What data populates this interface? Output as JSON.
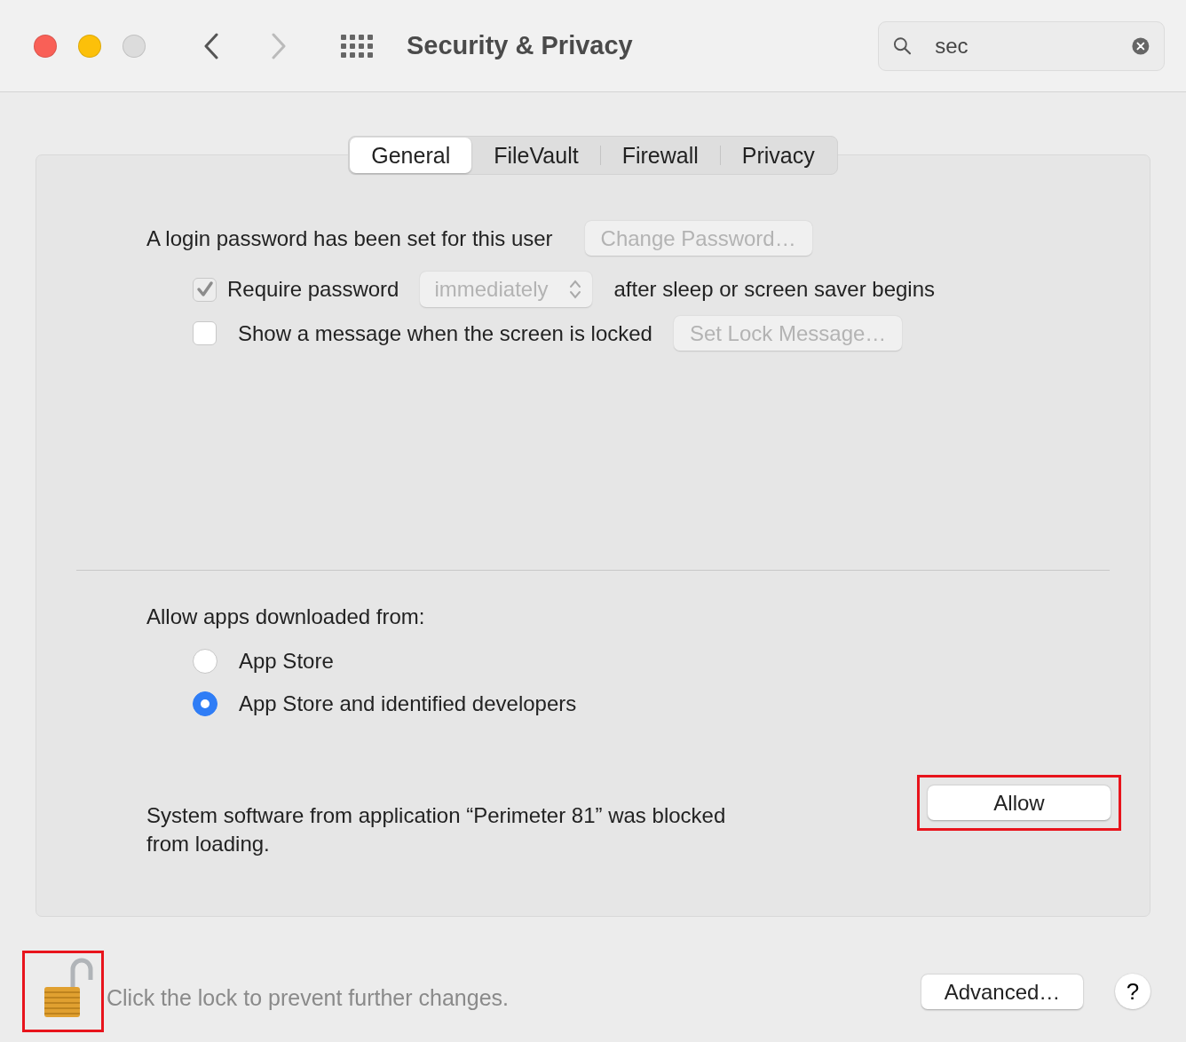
{
  "window": {
    "title": "Security & Privacy",
    "traffic_lights": [
      {
        "color": "#f96057"
      },
      {
        "color": "#fcc00a"
      },
      {
        "color": "#dcdcdc"
      }
    ]
  },
  "nav": {
    "back_enabled": true,
    "forward_enabled": false
  },
  "search": {
    "value": "sec"
  },
  "tabs": [
    {
      "label": "General",
      "selected": true
    },
    {
      "label": "FileVault",
      "selected": false
    },
    {
      "label": "Firewall",
      "selected": false
    },
    {
      "label": "Privacy",
      "selected": false
    }
  ],
  "general": {
    "login_text": "A login password has been set for this user",
    "change_password": {
      "label": "Change Password…",
      "disabled": true
    },
    "require_password": {
      "label": "Require password",
      "checked": true,
      "disabled": true,
      "delay": "immediately",
      "suffix": "after sleep or screen saver begins"
    },
    "show_message": {
      "label": "Show a message when the screen is locked",
      "checked": false,
      "button": {
        "label": "Set Lock Message…",
        "disabled": true
      }
    }
  },
  "allow_apps": {
    "label": "Allow apps downloaded from:",
    "options": [
      {
        "label": "App Store",
        "selected": false
      },
      {
        "label": "App Store and identified developers",
        "selected": true
      }
    ]
  },
  "blocked": {
    "message": "System software from application “Perimeter 81” was blocked from loading.",
    "button": {
      "label": "Allow",
      "highlighted": true
    }
  },
  "footer": {
    "lock": {
      "locked": false,
      "highlighted": true
    },
    "text": "Click the lock to prevent further changes.",
    "advanced": "Advanced…",
    "help": "?"
  }
}
